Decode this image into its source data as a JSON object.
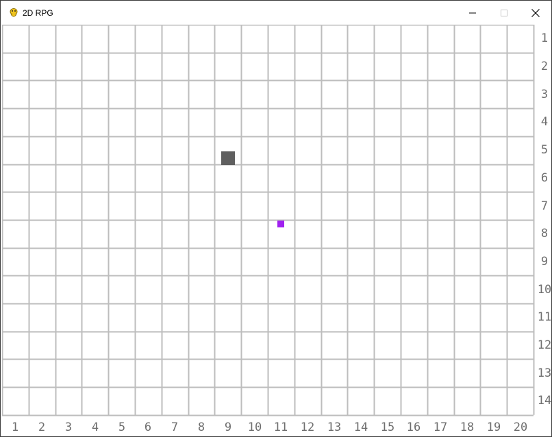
{
  "window": {
    "title": "2D RPG",
    "app_icon": "python-snake-icon",
    "controls": [
      "minimize-icon",
      "maximize-icon",
      "close-icon"
    ]
  },
  "grid": {
    "columns": 20,
    "rows": 14,
    "column_labels": [
      "1",
      "2",
      "3",
      "4",
      "5",
      "6",
      "7",
      "8",
      "9",
      "10",
      "11",
      "12",
      "13",
      "14",
      "15",
      "16",
      "17",
      "18",
      "19",
      "20"
    ],
    "row_labels": [
      "1",
      "2",
      "3",
      "4",
      "5",
      "6",
      "7",
      "8",
      "9",
      "10",
      "11",
      "12",
      "13",
      "14"
    ],
    "line_color": "#bdbdbd",
    "background": "#ffffff",
    "label_color": "#6e6e6e"
  },
  "entities": [
    {
      "name": "obstacle-block",
      "color": "#5f5f5f",
      "col": 8.5,
      "row": 5.3
    },
    {
      "name": "player-marker",
      "color": "#a020f0",
      "col": 11,
      "row": 8
    }
  ],
  "colors": {
    "titlebar_bg": "#ffffff",
    "titlebar_text": "#000000",
    "icon_dim": "#bfbfbf"
  }
}
